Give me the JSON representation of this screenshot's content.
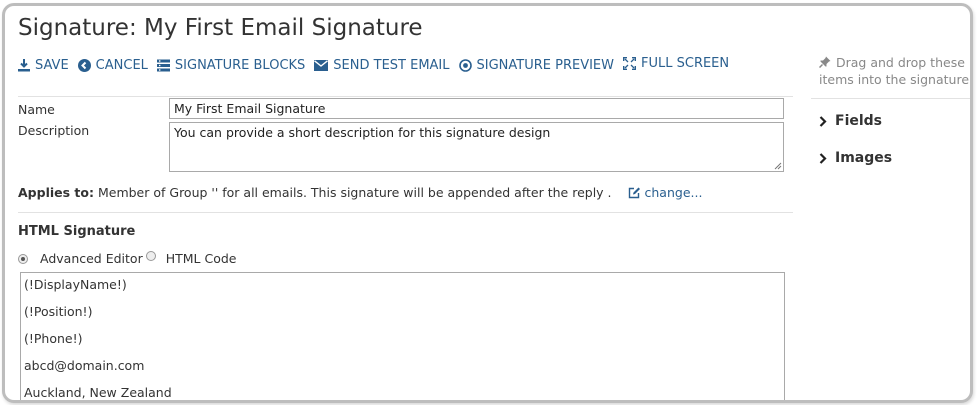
{
  "page": {
    "title": "Signature: My First Email Signature"
  },
  "toolbar": {
    "save_label": "SAVE",
    "cancel_label": "CANCEL",
    "blocks_label": "SIGNATURE BLOCKS",
    "test_label": "SEND TEST EMAIL",
    "preview_label": "SIGNATURE PREVIEW",
    "fullscreen_label": "FULL SCREEN"
  },
  "form": {
    "name_label": "Name",
    "name_value": "My First Email Signature",
    "description_label": "Description",
    "description_value": "You can provide a short description for this signature design",
    "applies_label": "Applies to:",
    "applies_text": "Member of Group '' for all emails. This signature will be appended after the reply .",
    "change_label": "change..."
  },
  "html_signature": {
    "title": "HTML Signature",
    "mode_advanced": "Advanced Editor",
    "mode_html": "HTML Code",
    "selected_mode": "Advanced Editor",
    "lines": [
      "(!DisplayName!)",
      "(!Position!)",
      "(!Phone!)",
      "abcd@domain.com",
      "Auckland, New Zealand"
    ]
  },
  "side_panel": {
    "hint": "Drag and drop these items into the signature",
    "fields_label": "Fields",
    "images_label": "Images"
  },
  "colors": {
    "link": "#2a5f8f",
    "border": "#bdbdbd"
  },
  "icons": [
    "download-icon",
    "back-circle-icon",
    "list-icon",
    "envelope-icon",
    "play-circle-icon",
    "expand-icon",
    "edit-icon",
    "pin-icon",
    "chevron-right-icon"
  ]
}
